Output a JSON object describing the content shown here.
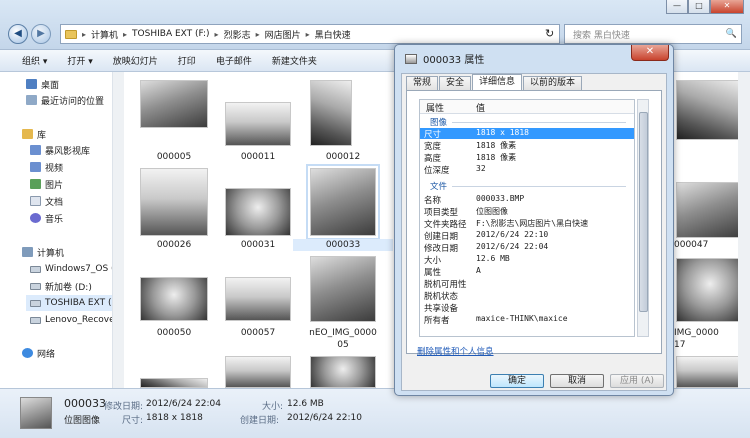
{
  "explorer": {
    "window_controls": {
      "minimize": "—",
      "maximize": "□",
      "close": "✕"
    },
    "nav": {
      "back": "◀",
      "forward": "▶"
    },
    "address": {
      "crumbs": [
        "计算机",
        "TOSHIBA EXT (F:)",
        "烈影志",
        "网店图片",
        "黑白快速"
      ],
      "separator": "▸",
      "refresh": "↻"
    },
    "search": {
      "placeholder": "搜索 黑白快速",
      "icon": "🔍"
    },
    "toolbar": {
      "organize": "组织 ▾",
      "open": "打开 ▾",
      "slideshow": "放映幻灯片",
      "print": "打印",
      "email": "电子邮件",
      "new_folder": "新建文件夹",
      "view": "▤ ▾",
      "help": "?"
    },
    "sidebar": {
      "desktop": "桌面",
      "recent": "最近访问的位置",
      "library": "库",
      "video_lib": "暴风影视库",
      "videos": "视频",
      "pictures": "图片",
      "documents": "文档",
      "music": "音乐",
      "computer": "计算机",
      "win7": "Windows7_OS (",
      "newvol": "新加卷 (D:)",
      "toshiba": "TOSHIBA EXT (I",
      "lenovo": "Lenovo_Recove",
      "network": "网络"
    },
    "files": [
      {
        "name": "000005"
      },
      {
        "name": "000011"
      },
      {
        "name": "000012"
      },
      {
        "name": "000026"
      },
      {
        "name": "000031"
      },
      {
        "name": "000033"
      },
      {
        "name": "000050"
      },
      {
        "name": "000057"
      },
      {
        "name": "nEO_IMG_0000",
        "name2": "05"
      },
      {
        "name": "000047"
      },
      {
        "name": "IMG_0000",
        "name2": "17"
      }
    ],
    "details": {
      "name": "000033",
      "type": "位图图像",
      "modified_label": "修改日期:",
      "modified": "2012/6/24 22:04",
      "dims_label": "尺寸:",
      "dims": "1818 x 1818",
      "size_label": "大小:",
      "size": "12.6 MB",
      "created_label": "创建日期:",
      "created": "2012/6/24 22:10"
    }
  },
  "dialog": {
    "title": "000033 属性",
    "close": "✕",
    "tabs": [
      "常规",
      "安全",
      "详细信息",
      "以前的版本"
    ],
    "header": {
      "prop": "属性",
      "val": "值"
    },
    "group_image": "图像",
    "group_file": "文件",
    "rows_image": [
      {
        "k": "尺寸",
        "v": "1818 x 1818"
      },
      {
        "k": "宽度",
        "v": "1818 像素"
      },
      {
        "k": "高度",
        "v": "1818 像素"
      },
      {
        "k": "位深度",
        "v": "32"
      }
    ],
    "rows_file": [
      {
        "k": "名称",
        "v": "000033.BMP"
      },
      {
        "k": "项目类型",
        "v": "位图图像"
      },
      {
        "k": "文件夹路径",
        "v": "F:\\烈影志\\网店图片\\黑白快速"
      },
      {
        "k": "创建日期",
        "v": "2012/6/24 22:10"
      },
      {
        "k": "修改日期",
        "v": "2012/6/24 22:04"
      },
      {
        "k": "大小",
        "v": "12.6 MB"
      },
      {
        "k": "属性",
        "v": "A"
      },
      {
        "k": "脱机可用性",
        "v": ""
      },
      {
        "k": "脱机状态",
        "v": ""
      },
      {
        "k": "共享设备",
        "v": ""
      },
      {
        "k": "所有者",
        "v": "maxice-THINK\\maxice"
      }
    ],
    "remove_link": "删除属性和个人信息",
    "ok": "确定",
    "cancel": "取消",
    "apply": "应用 (A)"
  }
}
